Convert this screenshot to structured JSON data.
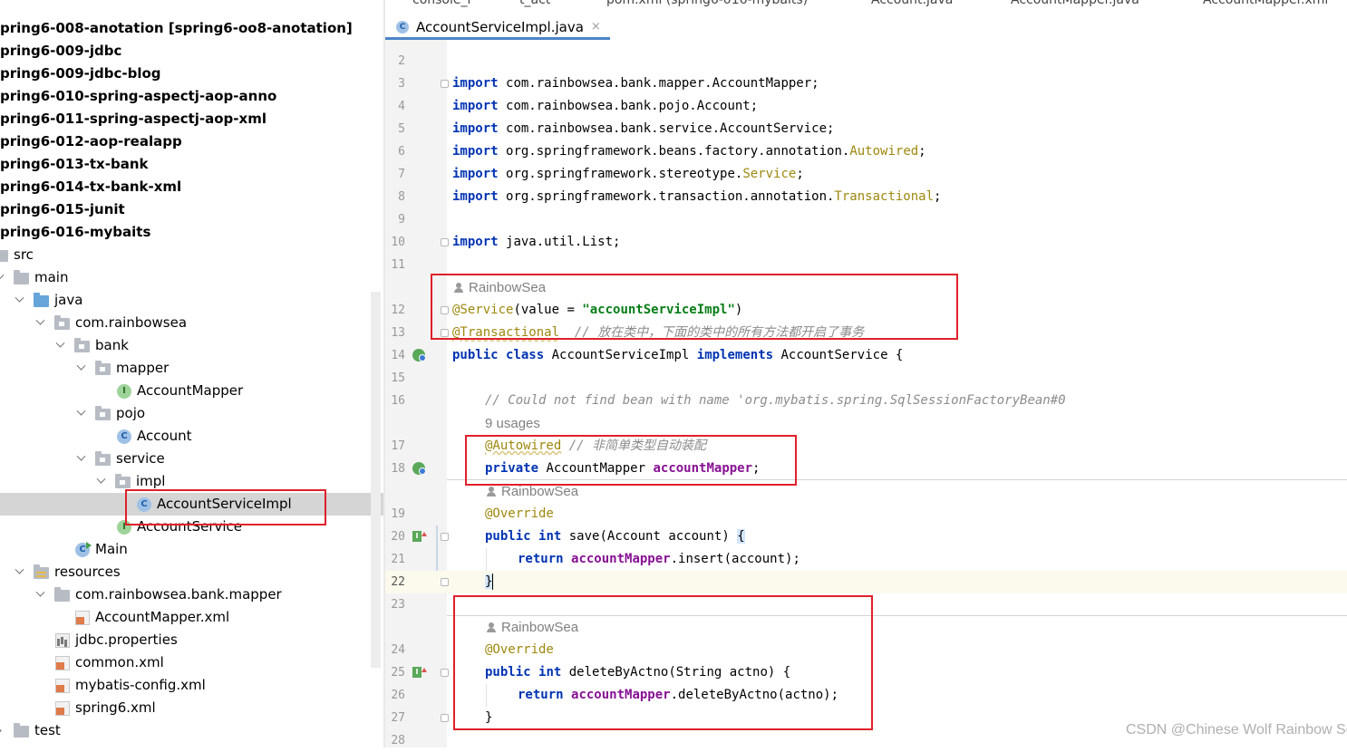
{
  "tabs": {
    "partial": [
      "console_r",
      "t_act",
      "pom.xml (spring6-016-mybaits)",
      "Account.java",
      "AccountMapper.java",
      "AccountMapper.xml"
    ],
    "active": {
      "label": "AccountServiceImpl.java",
      "close": "×"
    }
  },
  "tree": {
    "projects": [
      {
        "label": "pring6-008-anotation",
        "suffix": "[spring6-oo8-anotation]"
      },
      {
        "label": "pring6-009-jdbc"
      },
      {
        "label": "pring6-009-jdbc-blog"
      },
      {
        "label": "pring6-010-spring-aspectj-aop-anno"
      },
      {
        "label": "pring6-011-spring-aspectj-aop-xml"
      },
      {
        "label": "pring6-012-aop-realapp"
      },
      {
        "label": "pring6-013-tx-bank"
      },
      {
        "label": "pring6-014-tx-bank-xml"
      },
      {
        "label": "pring6-015-junit"
      },
      {
        "label": "pring6-016-mybaits"
      }
    ],
    "nodes": {
      "src": "src",
      "main": "main",
      "java": "java",
      "com_rainbowsea": "com.rainbowsea",
      "bank": "bank",
      "mapper": "mapper",
      "AccountMapper": "AccountMapper",
      "pojo": "pojo",
      "Account": "Account",
      "service": "service",
      "impl": "impl",
      "AccountServiceImpl": "AccountServiceImpl",
      "AccountService": "AccountService",
      "Main": "Main",
      "resources": "resources",
      "res_pkg": "com.rainbowsea.bank.mapper",
      "AccountMapper_xml": "AccountMapper.xml",
      "jdbc_properties": "jdbc.properties",
      "common_xml": "common.xml",
      "mybatis_config": "mybatis-config.xml",
      "spring6_xml": "spring6.xml",
      "test": "test"
    }
  },
  "code": {
    "line_numbers": [
      "2",
      "3",
      "4",
      "5",
      "6",
      "7",
      "8",
      "9",
      "10",
      "11",
      "12",
      "13",
      "14",
      "15",
      "16",
      "17",
      "18",
      "19",
      "20",
      "21",
      "22",
      "23",
      "24",
      "25",
      "26",
      "27",
      "28"
    ],
    "import_kw": "import",
    "imports": {
      "l3": "com.rainbowsea.bank.mapper.AccountMapper;",
      "l4": "com.rainbowsea.bank.pojo.Account;",
      "l5": "com.rainbowsea.bank.service.AccountService;",
      "l6_pre": "org.springframework.beans.factory.annotation.",
      "l6_cls": "Autowired",
      "l7_pre": "org.springframework.stereotype.",
      "l7_cls": "Service",
      "l8_pre": "org.springframework.transaction.annotation.",
      "l8_cls": "Transactional",
      "l10": "java.util.List;"
    },
    "author": "RainbowSea",
    "usages": "9 usages",
    "l12_ann": "@Service",
    "l12_open": "(value = ",
    "l12_str": "\"accountServiceImpl\"",
    "l12_close": ")",
    "l13_ann": "@Transactional",
    "l13_cmt": "// 放在类中，下面的类中的所有方法都开启了事务",
    "l14_kw1": "public",
    "l14_kw2": "class",
    "l14_name": "AccountServiceImpl",
    "l14_kw3": "implements",
    "l14_iface": "AccountService {",
    "l16_cmt": "// Could not find bean with name 'org.mybatis.spring.SqlSessionFactoryBean#0",
    "l17_ann": "@Autowired",
    "l17_cmt": "// 非简单类型自动装配",
    "l18_kw": "private",
    "l18_type": "AccountMapper",
    "l18_field": "accountMapper",
    "l18_end": ";",
    "override": "@Override",
    "l20_kw1": "public",
    "l20_kw2": "int",
    "l20_sig": "save(Account account) ",
    "l20_brace": "{",
    "return_kw": "return",
    "field": "accountMapper",
    "l21_call": ".insert(account);",
    "close_brace": "}",
    "l25_kw1": "public",
    "l25_kw2": "int",
    "l25_sig": "deleteByActno(String actno) {",
    "l26_call": ".deleteByActno(actno);"
  },
  "watermark": "CSDN @Chinese Wolf Rainbow Sea",
  "colors": {
    "keyword": "#0033b3",
    "annotation": "#9e880d",
    "string": "#067d17",
    "comment": "#8c8c8c",
    "field": "#871094",
    "highlight_box": "#e0202a"
  }
}
